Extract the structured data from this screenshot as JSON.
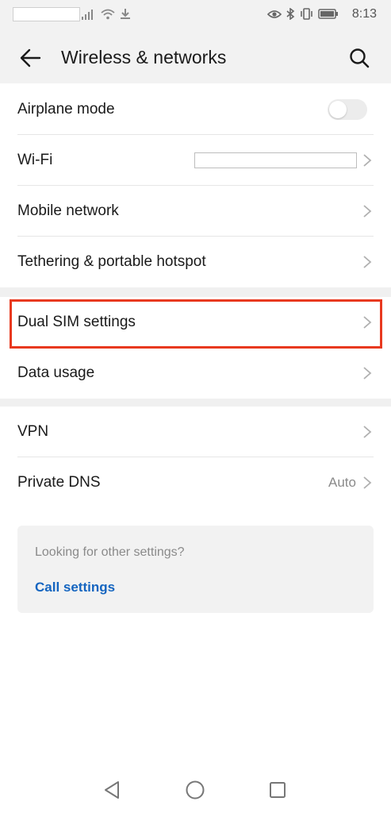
{
  "status_bar": {
    "time": "8:13"
  },
  "header": {
    "title": "Wireless & networks"
  },
  "groups": {
    "airplane_mode": {
      "label": "Airplane mode",
      "toggle_on": false
    },
    "wifi": {
      "label": "Wi-Fi"
    },
    "mobile_network": {
      "label": "Mobile network"
    },
    "tethering": {
      "label": "Tethering & portable hotspot"
    },
    "dual_sim": {
      "label": "Dual SIM settings"
    },
    "data_usage": {
      "label": "Data usage"
    },
    "vpn": {
      "label": "VPN"
    },
    "private_dns": {
      "label": "Private DNS",
      "value": "Auto"
    }
  },
  "suggestion_card": {
    "question": "Looking for other settings?",
    "link": "Call settings"
  },
  "colors": {
    "highlight": "#e8391f",
    "link": "#1565c0"
  },
  "icons": [
    "eye-icon",
    "bluetooth-icon",
    "vibrate-icon",
    "battery-icon",
    "signal-icon",
    "wifi-icon",
    "download-icon",
    "back-arrow-icon",
    "search-icon",
    "chevron-right-icon",
    "nav-back-icon",
    "nav-home-icon",
    "nav-recents-icon"
  ]
}
